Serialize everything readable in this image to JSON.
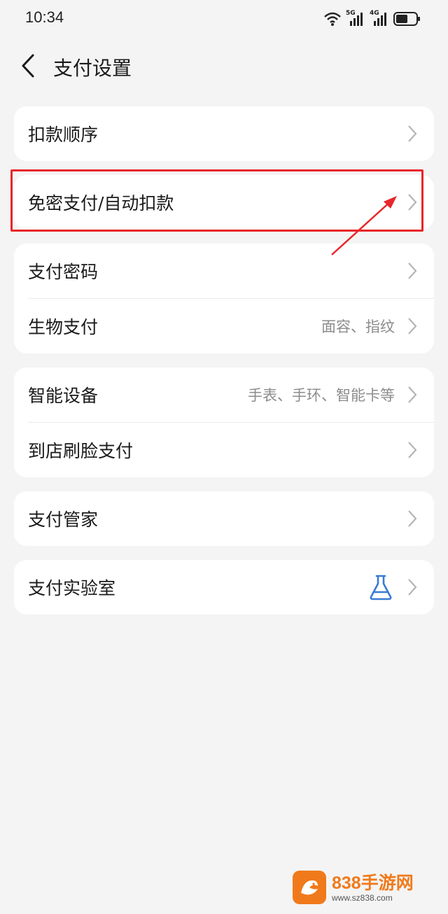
{
  "status_bar": {
    "time": "10:34",
    "signal_1": "5G",
    "signal_2": "4G"
  },
  "header": {
    "title": "支付设置",
    "back_icon": "chevron-left-icon"
  },
  "sections": [
    {
      "items": [
        {
          "label": "扣款顺序",
          "value": ""
        }
      ]
    },
    {
      "items": [
        {
          "label": "免密支付/自动扣款",
          "value": ""
        }
      ]
    },
    {
      "items": [
        {
          "label": "支付密码",
          "value": ""
        },
        {
          "label": "生物支付",
          "value": "面容、指纹"
        }
      ]
    },
    {
      "items": [
        {
          "label": "智能设备",
          "value": "手表、手环、智能卡等"
        },
        {
          "label": "到店刷脸支付",
          "value": ""
        }
      ]
    },
    {
      "items": [
        {
          "label": "支付管家",
          "value": ""
        }
      ]
    },
    {
      "items": [
        {
          "label": "支付实验室",
          "value": "",
          "icon": "flask-icon"
        }
      ]
    }
  ],
  "annotation": {
    "highlight_color": "#e8262a"
  },
  "watermark": {
    "brand": "838手游网",
    "url": "www.sz838.com"
  },
  "colors": {
    "background": "#f4f4f4",
    "card": "#ffffff",
    "flask": "#3a7bd5",
    "watermark_orange": "#f07a1b"
  }
}
